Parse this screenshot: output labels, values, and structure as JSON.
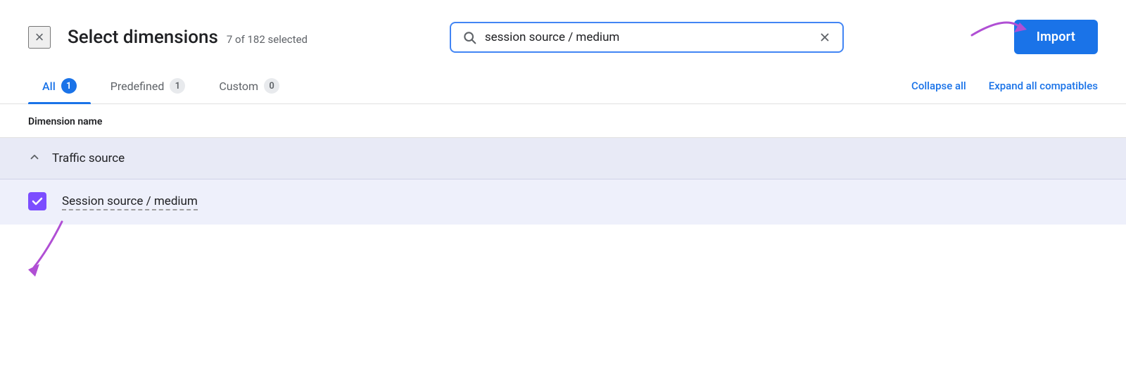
{
  "header": {
    "close_label": "×",
    "title": "Select dimensions",
    "selection_count": "7 of 182 selected",
    "search_value": "session source / medium",
    "import_label": "Import"
  },
  "tabs": {
    "items": [
      {
        "label": "All",
        "badge": "1",
        "active": true
      },
      {
        "label": "Predefined",
        "badge": "1",
        "active": false
      },
      {
        "label": "Custom",
        "badge": "0",
        "active": false
      }
    ],
    "collapse_all": "Collapse all",
    "expand_all": "Expand all compatibles"
  },
  "table": {
    "column_header": "Dimension name",
    "groups": [
      {
        "name": "Traffic source",
        "items": [
          {
            "label": "Session source / medium",
            "checked": true
          }
        ]
      }
    ]
  },
  "icons": {
    "search": "🔍",
    "close": "×",
    "chevron_up": "∧",
    "checkmark": "✓"
  },
  "colors": {
    "blue_accent": "#1a73e8",
    "purple_accent": "#7c4dff",
    "arrow_color": "#b04fd4"
  }
}
